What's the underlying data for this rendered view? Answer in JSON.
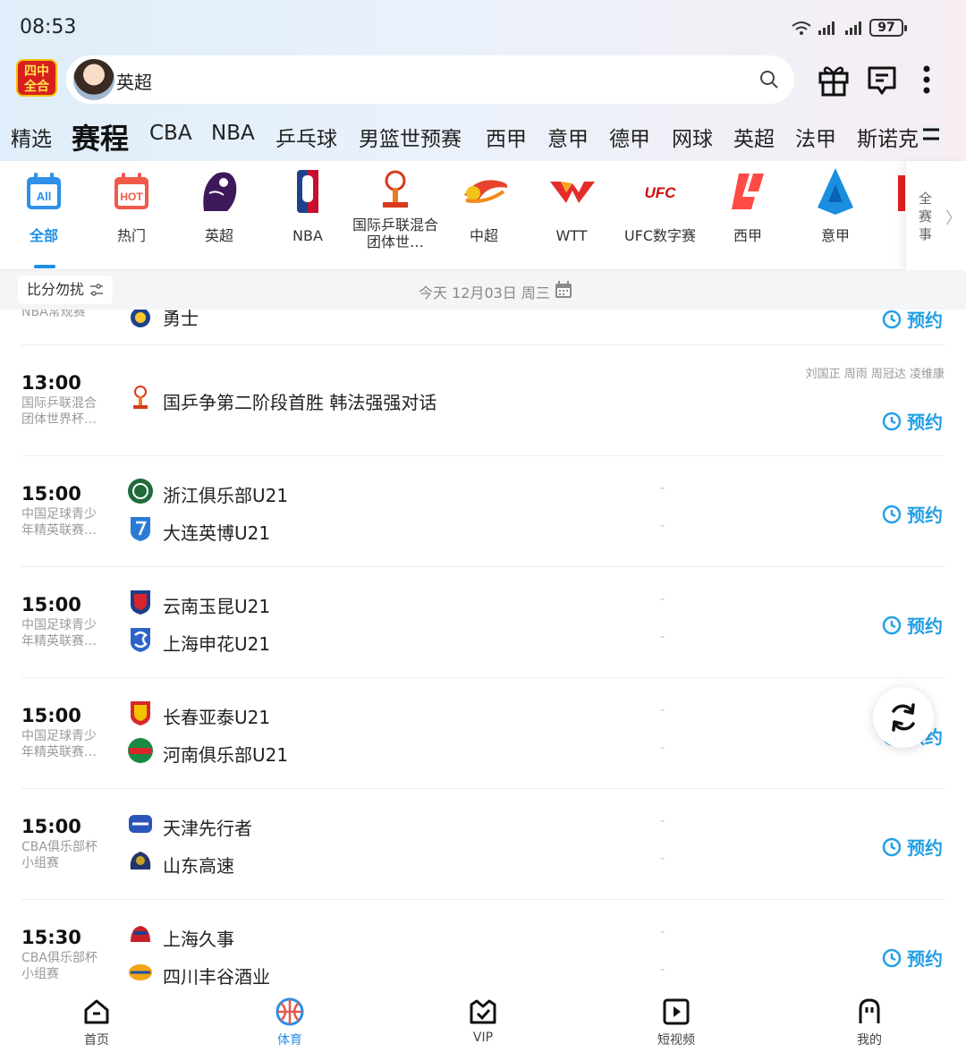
{
  "status_bar": {
    "time": "08:53",
    "battery": "97"
  },
  "header": {
    "logo_text_1": "四中",
    "logo_text_2": "全合",
    "search_text": "英超"
  },
  "nav_tabs": [
    "精选",
    "赛程",
    "CBA",
    "NBA",
    "乒乓球",
    "男篮世预赛",
    "西甲",
    "意甲",
    "德甲",
    "网球",
    "英超",
    "法甲",
    "斯诺克"
  ],
  "nav_active": "赛程",
  "leagues": [
    {
      "label": "全部",
      "icon": "all-calendar-icon",
      "active": true
    },
    {
      "label": "热门",
      "icon": "hot-calendar-icon"
    },
    {
      "label": "英超",
      "icon": "premier-league-icon"
    },
    {
      "label": "NBA",
      "icon": "nba-icon"
    },
    {
      "label": "国际乒联混合团体世…",
      "icon": "ittf-chengdu-icon"
    },
    {
      "label": "中超",
      "icon": "csl-icon"
    },
    {
      "label": "WTT",
      "icon": "wtt-icon"
    },
    {
      "label": "UFC数字赛",
      "icon": "ufc-icon"
    },
    {
      "label": "西甲",
      "icon": "laliga-icon"
    },
    {
      "label": "意甲",
      "icon": "serie-a-icon"
    }
  ],
  "all_leagues_label": "全赛事",
  "date_bar": {
    "no_disturb": "比分勿扰",
    "date": "今天 12月03日 周三"
  },
  "partial_row": {
    "comp": "NBA常规赛",
    "team": "勇士",
    "reserve": "预约"
  },
  "matches": [
    {
      "time": "13:00",
      "comp": "国际乒联混合团体世界杯…",
      "title": "国乒争第二阶段首胜 韩法强强对话",
      "players": "刘国正 周雨 周冠达 凌维康",
      "reserve": "预约"
    },
    {
      "time": "15:00",
      "comp": "中国足球青少年精英联赛…",
      "home": "浙江俱乐部U21",
      "away": "大连英博U21",
      "home_score": "-",
      "away_score": "-",
      "reserve": "预约"
    },
    {
      "time": "15:00",
      "comp": "中国足球青少年精英联赛…",
      "home": "云南玉昆U21",
      "away": "上海申花U21",
      "home_score": "-",
      "away_score": "-",
      "reserve": "预约"
    },
    {
      "time": "15:00",
      "comp": "中国足球青少年精英联赛…",
      "home": "长春亚泰U21",
      "away": "河南俱乐部U21",
      "home_score": "-",
      "away_score": "-",
      "reserve": "预约"
    },
    {
      "time": "15:00",
      "comp": "CBA俱乐部杯小组赛",
      "home": "天津先行者",
      "away": "山东高速",
      "home_score": "-",
      "away_score": "-",
      "reserve": "预约"
    },
    {
      "time": "15:30",
      "comp": "CBA俱乐部杯小组赛",
      "home": "上海久事",
      "away": "四川丰谷酒业",
      "home_score": "-",
      "away_score": "-",
      "reserve": "预约"
    }
  ],
  "bottom_nav": [
    {
      "label": "首页",
      "icon": "home-icon"
    },
    {
      "label": "体育",
      "icon": "basketball-icon",
      "active": true
    },
    {
      "label": "VIP",
      "icon": "vip-icon"
    },
    {
      "label": "短视频",
      "icon": "video-icon"
    },
    {
      "label": "我的",
      "icon": "profile-icon"
    }
  ],
  "colors": {
    "accent": "#1e8fe6",
    "reserve": "#23a0e6"
  }
}
